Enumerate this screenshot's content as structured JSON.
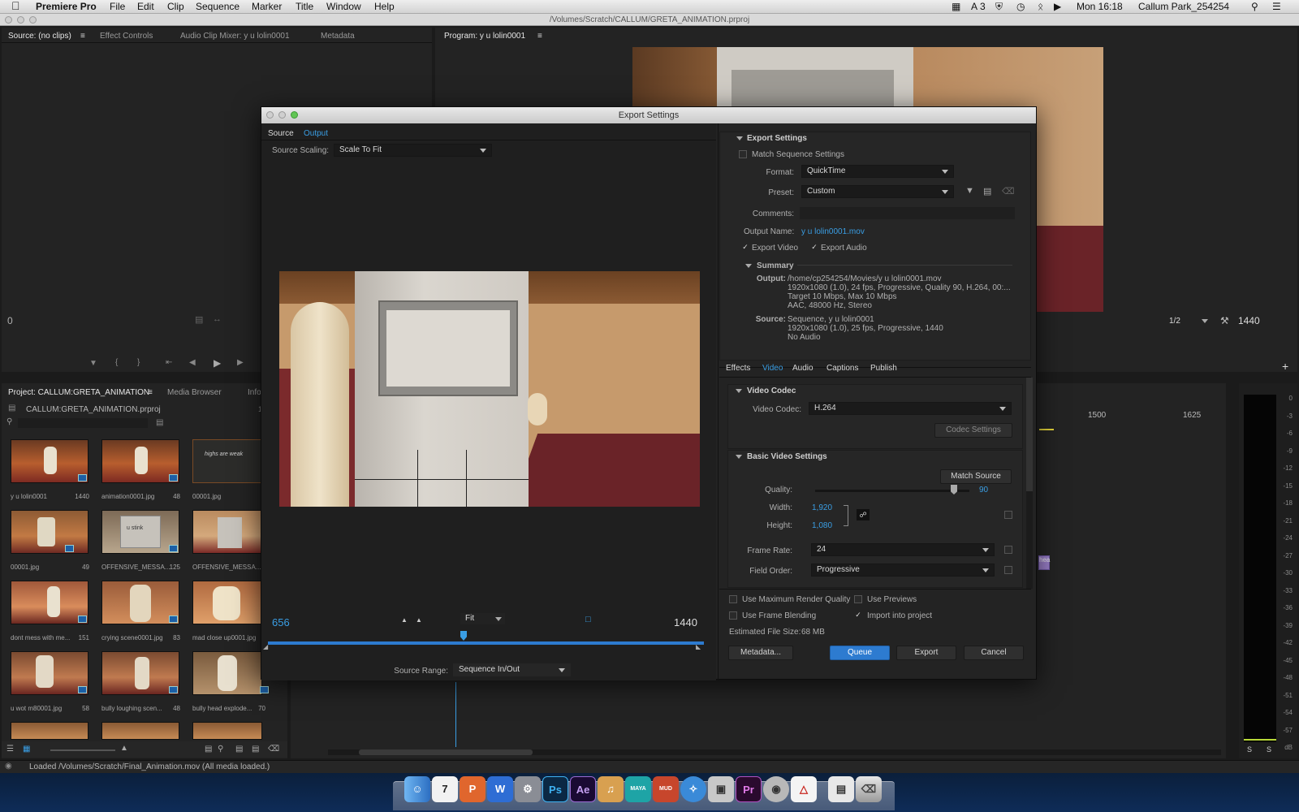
{
  "menubar": {
    "apple": "",
    "app_name": "Premiere Pro",
    "items": [
      "File",
      "Edit",
      "Clip",
      "Sequence",
      "Marker",
      "Title",
      "Window",
      "Help"
    ],
    "status": {
      "count": "3",
      "time": "Mon 16:18",
      "user": "Callum Park_254254"
    }
  },
  "app_title": "/Volumes/Scratch/CALLUM/GRETA_ANIMATION.prproj",
  "source_panel": {
    "tabs": [
      "Source: (no clips)",
      "Effect Controls",
      "Audio Clip Mixer: y u lolin0001",
      "Metadata"
    ],
    "timecode": "0"
  },
  "program_panel": {
    "tab": "Program: y u lolin0001",
    "zoom": "1/2",
    "timecode": "1440"
  },
  "project_panel": {
    "tabs": [
      "Project: CALLUM:GRETA_ANIMATION",
      "Media Browser",
      "Info"
    ],
    "project_file": "CALLUM:GRETA_ANIMATION.prproj",
    "count": "1",
    "items": [
      {
        "name": "y u lolin0001",
        "dur": "1440"
      },
      {
        "name": "animation0001.jpg",
        "dur": "48"
      },
      {
        "name": "00001.jpg",
        "dur": ""
      },
      {
        "name": "00001.jpg",
        "dur": "49"
      },
      {
        "name": "OFFENSIVE_MESSA...",
        "dur": "125"
      },
      {
        "name": "OFFENSIVE_MESSA...",
        "dur": ""
      },
      {
        "name": "dont mess with me...",
        "dur": "151"
      },
      {
        "name": "crying scene0001.jpg",
        "dur": "83"
      },
      {
        "name": "mad close up0001.jpg",
        "dur": ""
      },
      {
        "name": "u wot m80001.jpg",
        "dur": "58"
      },
      {
        "name": "bully loughing scen...",
        "dur": "48"
      },
      {
        "name": "bully head explode...",
        "dur": "70"
      }
    ],
    "thumb_text": {
      "chalkboard": "highs are weak",
      "screen": "u stink"
    }
  },
  "timeline": {
    "ruler": [
      "1500",
      "1625"
    ],
    "clip_label": "hea"
  },
  "meter": {
    "scale": [
      "0",
      "-3",
      "-6",
      "-9",
      "-12",
      "-15",
      "-18",
      "-21",
      "-24",
      "-27",
      "-30",
      "-33",
      "-36",
      "-39",
      "-42",
      "-45",
      "-48",
      "-51",
      "-54",
      "-57",
      "dB"
    ],
    "solo": [
      "S",
      "S"
    ]
  },
  "status_bar": "Loaded /Volumes/Scratch/Final_Animation.mov (All media loaded.)",
  "export": {
    "title": "Export Settings",
    "left_tabs": [
      "Source",
      "Output"
    ],
    "source_scaling_label": "Source Scaling:",
    "source_scaling_value": "Scale To Fit",
    "in_point": "656",
    "out_point": "1440",
    "fit_value": "Fit",
    "source_range_label": "Source Range:",
    "source_range_value": "Sequence In/Out",
    "section_export_settings": "Export Settings",
    "match_sequence": "Match Sequence Settings",
    "format_label": "Format:",
    "format_value": "QuickTime",
    "preset_label": "Preset:",
    "preset_value": "Custom",
    "comments_label": "Comments:",
    "output_name_label": "Output Name:",
    "output_name_value": "y u lolin0001.mov",
    "export_video": "Export Video",
    "export_audio": "Export Audio",
    "summary_title": "Summary",
    "summary_output_label": "Output:",
    "summary_output_lines": [
      "/home/cp254254/Movies/y u lolin0001.mov",
      "1920x1080 (1.0), 24 fps, Progressive, Quality 90, H.264, 00:...",
      "Target 10 Mbps, Max 10 Mbps",
      "AAC, 48000 Hz, Stereo"
    ],
    "summary_source_label": "Source:",
    "summary_source_lines": [
      "Sequence, y u lolin0001",
      "1920x1080 (1.0), 25 fps, Progressive, 1440",
      "No Audio"
    ],
    "settings_tabs": [
      "Effects",
      "Video",
      "Audio",
      "Captions",
      "Publish"
    ],
    "video_codec_section": "Video Codec",
    "video_codec_label": "Video Codec:",
    "video_codec_value": "H.264",
    "codec_settings": "Codec Settings",
    "basic_video_section": "Basic Video Settings",
    "match_source": "Match Source",
    "quality_label": "Quality:",
    "quality_value": "90",
    "quality_fraction": 0.9,
    "width_label": "Width:",
    "width_value": "1,920",
    "height_label": "Height:",
    "height_value": "1,080",
    "frame_rate_label": "Frame Rate:",
    "frame_rate_value": "24",
    "field_order_label": "Field Order:",
    "field_order_value": "Progressive",
    "use_max_render": "Use Maximum Render Quality",
    "use_previews": "Use Previews",
    "use_frame_blending": "Use Frame Blending",
    "import_into_project": "Import into project",
    "estimated_size_label": "Estimated File Size:",
    "estimated_size_value": "68 MB",
    "metadata_button": "Metadata...",
    "queue_button": "Queue",
    "export_button": "Export",
    "cancel_button": "Cancel"
  },
  "dock": {
    "apps": [
      "Finder",
      "Calendar",
      "PowerPoint",
      "Word",
      "Preferences",
      "Photoshop",
      "After Effects",
      "GarageBand",
      "Maya",
      "Mudbox",
      "Safari",
      "Preview",
      "Premiere",
      "Steam",
      "Acrobat",
      "Document",
      "Trash"
    ],
    "calendar_day": "7",
    "labels": {
      "ps": "Ps",
      "ae": "Ae",
      "pr": "Pr",
      "maya": "MAYA",
      "mud": "MUD"
    }
  },
  "colors": {
    "accent": "#2d7bd0",
    "link": "#3a9ee4",
    "panel": "#232323"
  }
}
